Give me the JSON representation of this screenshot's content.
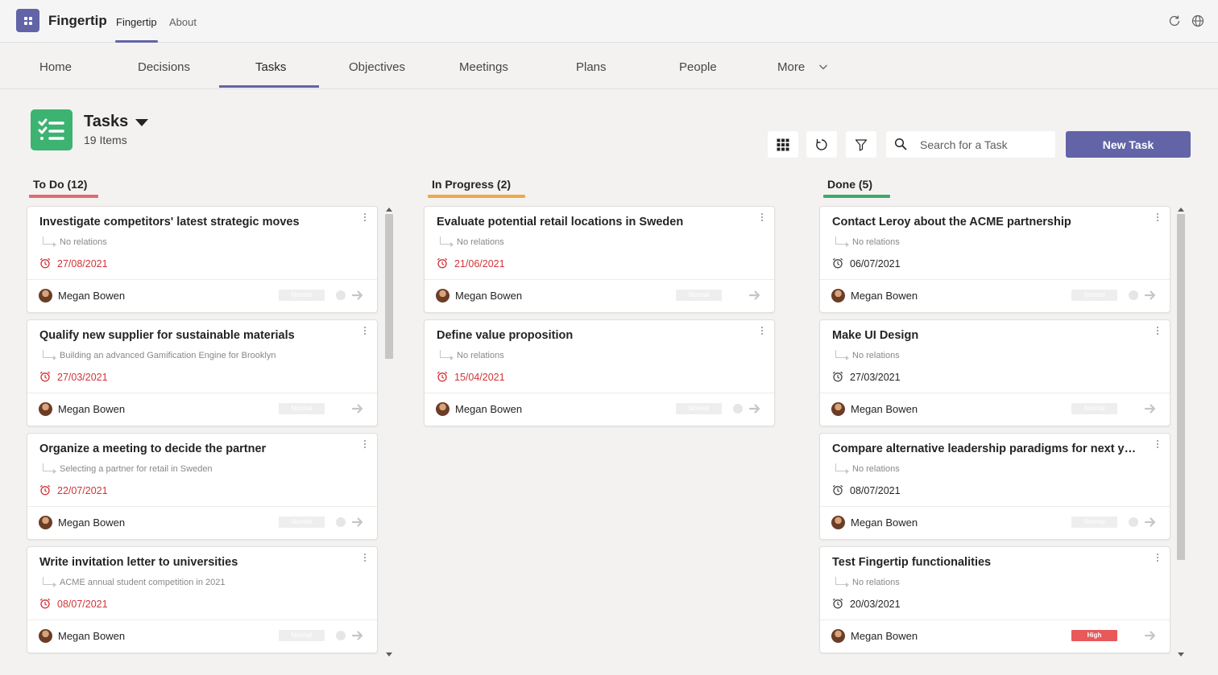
{
  "app": {
    "name": "Fingertip",
    "tabs": [
      {
        "label": "Fingertip",
        "active": true
      },
      {
        "label": "About",
        "active": false
      }
    ]
  },
  "nav": {
    "items": [
      "Home",
      "Decisions",
      "Tasks",
      "Objectives",
      "Meetings",
      "Plans",
      "People",
      "More"
    ],
    "active": "Tasks"
  },
  "header": {
    "title": "Tasks",
    "count": "19 Items",
    "search_placeholder": "Search for a Task",
    "new_task_label": "New Task"
  },
  "colors": {
    "accent": "#6264a7",
    "overdue": "#d13438",
    "todo": "#e06a6f",
    "in_progress": "#f0a845",
    "done": "#3ea86b",
    "high": "#e8595a"
  },
  "columns": [
    {
      "title": "To Do (12)",
      "cards": [
        {
          "title": "Investigate competitors' latest strategic moves",
          "relation": "No relations",
          "date": "27/08/2021",
          "overdue": true,
          "assignee": "Megan Bowen",
          "priority": "Normal",
          "dot": true
        },
        {
          "title": "Qualify new supplier for sustainable materials",
          "relation": "Building an advanced Gamification Engine for Brooklyn",
          "date": "27/03/2021",
          "overdue": true,
          "assignee": "Megan Bowen",
          "priority": "Normal",
          "dot": false
        },
        {
          "title": "Organize a meeting to decide the partner",
          "relation": "Selecting a partner for retail in Sweden",
          "date": "22/07/2021",
          "overdue": true,
          "assignee": "Megan Bowen",
          "priority": "Normal",
          "dot": true
        },
        {
          "title": "Write invitation letter to universities",
          "relation": "ACME annual student competition in 2021",
          "date": "08/07/2021",
          "overdue": true,
          "assignee": "Megan Bowen",
          "priority": "Normal",
          "dot": true
        }
      ]
    },
    {
      "title": "In Progress (2)",
      "cards": [
        {
          "title": "Evaluate potential retail locations in Sweden",
          "relation": "No relations",
          "date": "21/06/2021",
          "overdue": true,
          "assignee": "Megan Bowen",
          "priority": "Normal",
          "dot": false
        },
        {
          "title": "Define value proposition",
          "relation": "No relations",
          "date": "15/04/2021",
          "overdue": true,
          "assignee": "Megan Bowen",
          "priority": "Normal",
          "dot": true
        }
      ]
    },
    {
      "title": "Done (5)",
      "cards": [
        {
          "title": "Contact Leroy about the ACME partnership",
          "relation": "No relations",
          "date": "06/07/2021",
          "overdue": false,
          "assignee": "Megan Bowen",
          "priority": "Normal",
          "dot": true
        },
        {
          "title": "Make UI Design",
          "relation": "No relations",
          "date": "27/03/2021",
          "overdue": false,
          "assignee": "Megan Bowen",
          "priority": "Normal",
          "dot": false
        },
        {
          "title": "Compare alternative leadership paradigms for next ye...",
          "relation": "No relations",
          "date": "08/07/2021",
          "overdue": false,
          "assignee": "Megan Bowen",
          "priority": "Normal",
          "dot": true
        },
        {
          "title": "Test Fingertip functionalities",
          "relation": "No relations",
          "date": "20/03/2021",
          "overdue": false,
          "assignee": "Megan Bowen",
          "priority": "High",
          "dot": false
        }
      ]
    }
  ]
}
